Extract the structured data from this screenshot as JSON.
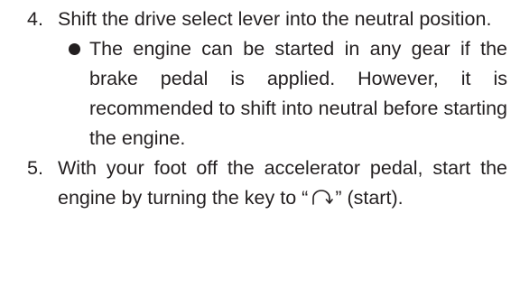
{
  "steps": [
    {
      "number": "4.",
      "text": "Shift the drive select lever into the neutral position."
    },
    {
      "number": "5.",
      "text_before": "With your foot off the accelerator pedal, start the engine by turning the key to",
      "quote_open": "“",
      "key_position_icon": "engine-start-icon",
      "quote_close": "”",
      "text_after": "(start)."
    }
  ],
  "bullet": {
    "text": "The engine can be started in any gear if the brake pedal is applied. However, it is recommended to shift into neutral before starting the engine."
  }
}
